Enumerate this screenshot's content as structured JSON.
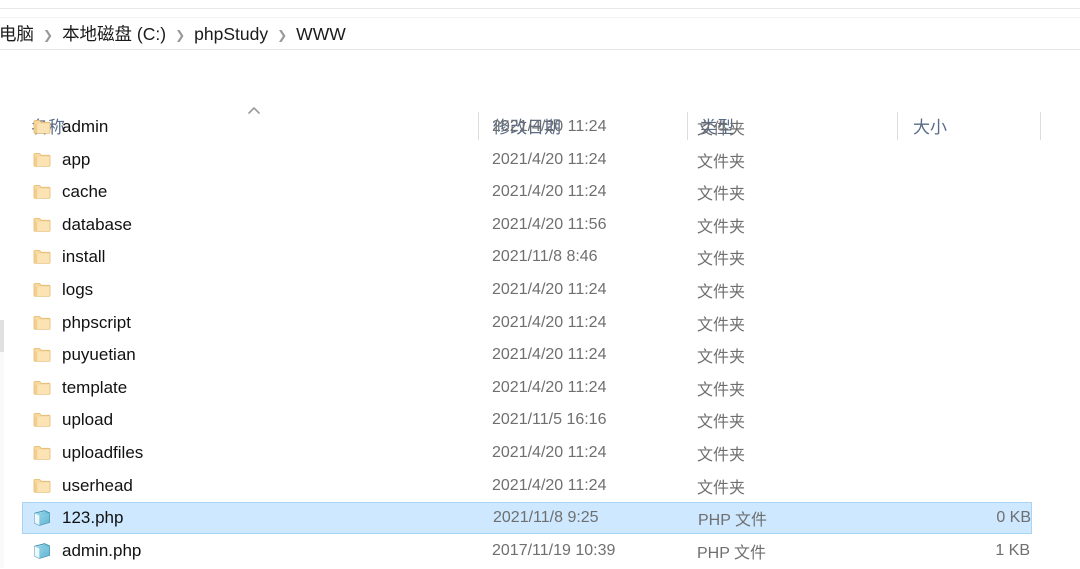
{
  "breadcrumb": {
    "items": [
      {
        "label": "电脑"
      },
      {
        "label": "本地磁盘 (C:)"
      },
      {
        "label": "phpStudy"
      },
      {
        "label": "WWW"
      }
    ],
    "separator": "❯"
  },
  "columns": {
    "name": "名称",
    "date_modified": "修改日期",
    "type": "类型",
    "size": "大小",
    "sort_indicator": "ascending-sort-arrow"
  },
  "colors": {
    "selection_fill": "#cde8ff",
    "selection_border": "#a8d4f5",
    "header_text": "#5a6b86",
    "folder_icon": "#f5d089",
    "php_icon": "#4aa8c8"
  },
  "files": [
    {
      "name": "admin",
      "date": "2021/4/20 11:24",
      "type": "文件夹",
      "size": "",
      "icon": "folder-icon",
      "selected": false
    },
    {
      "name": "app",
      "date": "2021/4/20 11:24",
      "type": "文件夹",
      "size": "",
      "icon": "folder-icon",
      "selected": false
    },
    {
      "name": "cache",
      "date": "2021/4/20 11:24",
      "type": "文件夹",
      "size": "",
      "icon": "folder-icon",
      "selected": false
    },
    {
      "name": "database",
      "date": "2021/4/20 11:56",
      "type": "文件夹",
      "size": "",
      "icon": "folder-icon",
      "selected": false
    },
    {
      "name": "install",
      "date": "2021/11/8 8:46",
      "type": "文件夹",
      "size": "",
      "icon": "folder-icon",
      "selected": false
    },
    {
      "name": "logs",
      "date": "2021/4/20 11:24",
      "type": "文件夹",
      "size": "",
      "icon": "folder-icon",
      "selected": false
    },
    {
      "name": "phpscript",
      "date": "2021/4/20 11:24",
      "type": "文件夹",
      "size": "",
      "icon": "folder-icon",
      "selected": false
    },
    {
      "name": "puyuetian",
      "date": "2021/4/20 11:24",
      "type": "文件夹",
      "size": "",
      "icon": "folder-icon",
      "selected": false
    },
    {
      "name": "template",
      "date": "2021/4/20 11:24",
      "type": "文件夹",
      "size": "",
      "icon": "folder-icon",
      "selected": false
    },
    {
      "name": "upload",
      "date": "2021/11/5 16:16",
      "type": "文件夹",
      "size": "",
      "icon": "folder-icon",
      "selected": false
    },
    {
      "name": "uploadfiles",
      "date": "2021/4/20 11:24",
      "type": "文件夹",
      "size": "",
      "icon": "folder-icon",
      "selected": false
    },
    {
      "name": "userhead",
      "date": "2021/4/20 11:24",
      "type": "文件夹",
      "size": "",
      "icon": "folder-icon",
      "selected": false
    },
    {
      "name": "123.php",
      "date": "2021/11/8 9:25",
      "type": "PHP 文件",
      "size": "0 KB",
      "icon": "php-file-icon",
      "selected": true
    },
    {
      "name": "admin.php",
      "date": "2017/11/19 10:39",
      "type": "PHP 文件",
      "size": "1 KB",
      "icon": "php-file-icon",
      "selected": false
    }
  ]
}
